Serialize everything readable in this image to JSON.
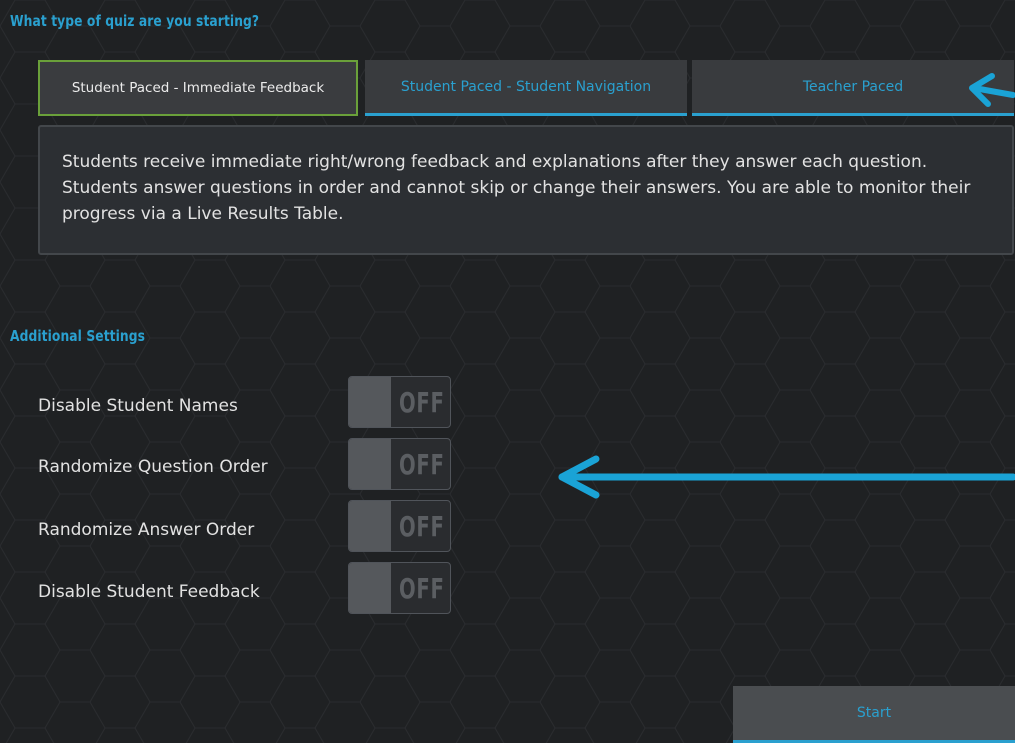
{
  "colors": {
    "background": "#1f2123",
    "heading": "#2aa0cf",
    "tab_inactive_text": "#2aa0cf",
    "accent_blue": "#2aa0cf",
    "active_tab_border": "#6aa03a",
    "annotation_arrow": "#1aa3d6"
  },
  "quiz_type": {
    "heading": "What type of quiz are you starting?",
    "tabs": [
      {
        "label": "Student Paced - Immediate Feedback",
        "selected": true
      },
      {
        "label": "Student Paced - Student Navigation",
        "selected": false
      },
      {
        "label": "Teacher Paced",
        "selected": false
      }
    ],
    "description": "Students receive immediate right/wrong feedback and explanations after they answer each question. Students answer questions in order and cannot skip or change their answers. You are able to monitor their progress via a Live Results Table."
  },
  "additional_settings": {
    "heading": "Additional Settings",
    "items": [
      {
        "label": "Disable Student Names",
        "state": "OFF"
      },
      {
        "label": "Randomize Question Order",
        "state": "OFF"
      },
      {
        "label": "Randomize Answer Order",
        "state": "OFF"
      },
      {
        "label": "Disable Student Feedback",
        "state": "OFF"
      }
    ]
  },
  "start_button": {
    "label": "Start"
  },
  "annotations": [
    {
      "name": "arrow-to-tabs",
      "icon": "left-arrow"
    },
    {
      "name": "arrow-to-settings",
      "icon": "left-arrow"
    }
  ]
}
